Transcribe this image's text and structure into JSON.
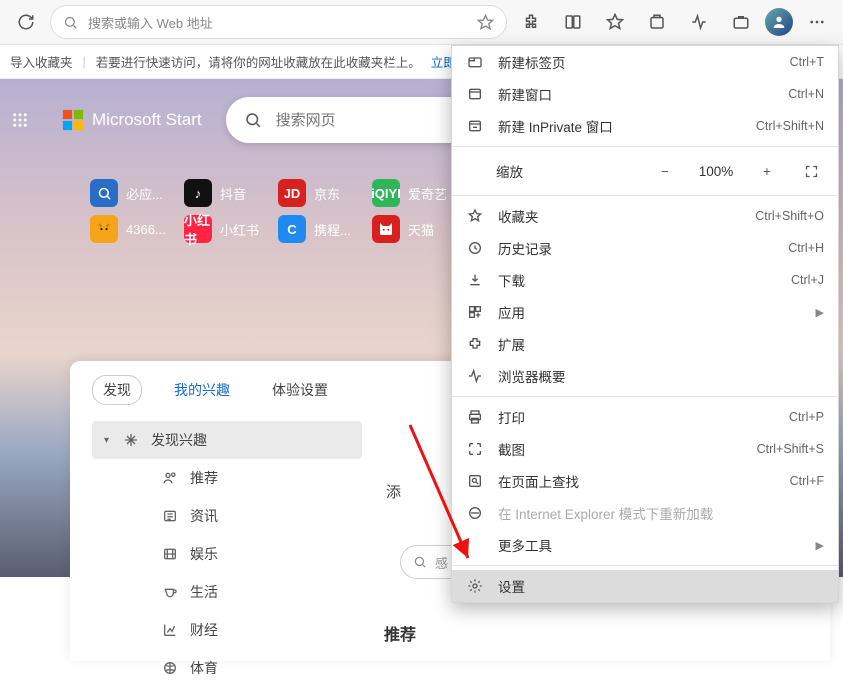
{
  "toolbar": {
    "address_placeholder": "搜索或输入 Web 地址"
  },
  "infobar": {
    "import_label": "导入收藏夹",
    "hint": "若要进行快速访问，请将你的网址收藏放在此收藏夹栏上。",
    "link": "立即管理收"
  },
  "hero": {
    "brand": "Microsoft Start",
    "search_placeholder": "搜索网页",
    "tiles": [
      {
        "label": "必应...",
        "ic": "ic-bing",
        "glyph": ""
      },
      {
        "label": "抖音",
        "ic": "ic-dy",
        "glyph": "♪"
      },
      {
        "label": "京东",
        "ic": "ic-jd",
        "glyph": "JD"
      },
      {
        "label": "爱奇艺",
        "ic": "ic-iqy",
        "glyph": "iQIYI"
      },
      {
        "label": "4366...",
        "ic": "ic-4366",
        "glyph": ""
      },
      {
        "label": "小红书",
        "ic": "ic-xhs",
        "glyph": "小红书"
      },
      {
        "label": "携程...",
        "ic": "ic-xc",
        "glyph": "C"
      },
      {
        "label": "天猫",
        "ic": "ic-tm",
        "glyph": ""
      }
    ]
  },
  "card": {
    "tabs": [
      "发现",
      "我的兴趣",
      "体验设置"
    ],
    "active_tab": 1,
    "side": [
      {
        "label": "发现兴趣",
        "active": true,
        "icon": "sparkles"
      },
      {
        "label": "推荐",
        "icon": "people"
      },
      {
        "label": "资讯",
        "icon": "news"
      },
      {
        "label": "娱乐",
        "icon": "film"
      },
      {
        "label": "生活",
        "icon": "cup"
      },
      {
        "label": "财经",
        "icon": "chart"
      },
      {
        "label": "体育",
        "icon": "ball"
      }
    ],
    "right_hint": "添",
    "search_hint": "感",
    "recommend": "推荐"
  },
  "menu": {
    "items": [
      {
        "icon": "tab",
        "label": "新建标签页",
        "shortcut": "Ctrl+T"
      },
      {
        "icon": "window",
        "label": "新建窗口",
        "shortcut": "Ctrl+N"
      },
      {
        "icon": "private",
        "label": "新建 InPrivate 窗口",
        "shortcut": "Ctrl+Shift+N"
      }
    ],
    "zoom": {
      "label": "缩放",
      "value": "100%"
    },
    "items2": [
      {
        "icon": "star",
        "label": "收藏夹",
        "shortcut": "Ctrl+Shift+O"
      },
      {
        "icon": "history",
        "label": "历史记录",
        "shortcut": "Ctrl+H"
      },
      {
        "icon": "download",
        "label": "下载",
        "shortcut": "Ctrl+J"
      },
      {
        "icon": "apps",
        "label": "应用",
        "chev": true
      },
      {
        "icon": "ext",
        "label": "扩展"
      },
      {
        "icon": "perf",
        "label": "浏览器概要"
      }
    ],
    "items3": [
      {
        "icon": "print",
        "label": "打印",
        "shortcut": "Ctrl+P"
      },
      {
        "icon": "shot",
        "label": "截图",
        "shortcut": "Ctrl+Shift+S"
      },
      {
        "icon": "find",
        "label": "在页面上查找",
        "shortcut": "Ctrl+F"
      },
      {
        "icon": "ie",
        "label": "在 Internet Explorer 模式下重新加载",
        "disabled": true
      },
      {
        "icon": "",
        "label": "更多工具",
        "chev": true
      }
    ],
    "settings": {
      "icon": "gear",
      "label": "设置"
    }
  }
}
